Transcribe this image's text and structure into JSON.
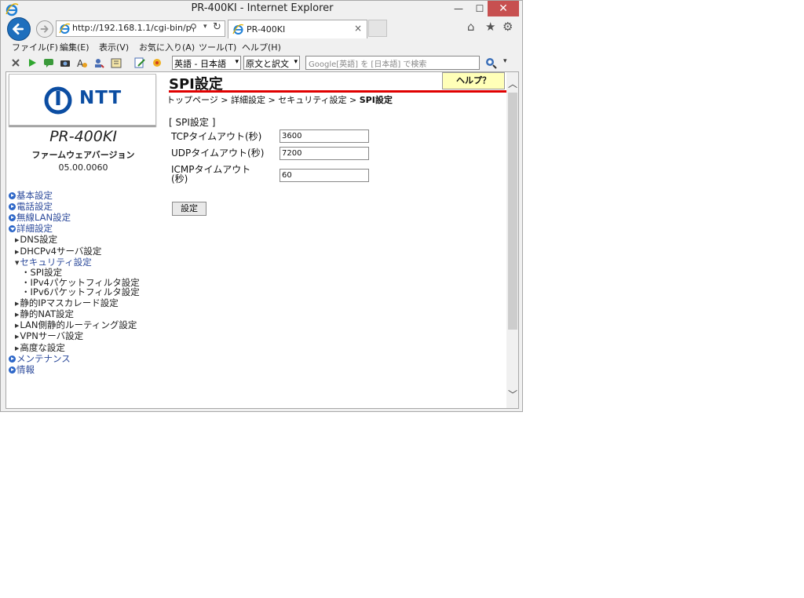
{
  "window": {
    "title": "PR-400KI - Internet Explorer",
    "min_symbol": "—",
    "max_symbol": "☐",
    "close_symbol": "✕"
  },
  "address": {
    "url": "http://192.168.1.1/cgi-bin/p",
    "search_symbol": "⚲",
    "drop_symbol": "▾",
    "refresh_symbol": "↻"
  },
  "tab": {
    "label": "PR-400KI",
    "close_symbol": "×"
  },
  "toolbar_right": {
    "home_symbol": "⌂",
    "fav_symbol": "★",
    "gear_symbol": "⚙"
  },
  "menu": {
    "items": [
      "ファイル(F)",
      "編集(E)",
      "表示(V)",
      "お気に入り(A)",
      "ツール(T)",
      "ヘルプ(H)"
    ]
  },
  "translate_toolbar": {
    "lang_select": "英語 - 日本語",
    "mode_select": "原文と訳文",
    "search_placeholder": "Google[英語] を [日本語] で検索",
    "arrow": "▾"
  },
  "sidebar": {
    "logo_text": "NTT",
    "model": "PR-400KI",
    "fw_label": "ファームウェアバージョン",
    "fw_version": "05.00.0060",
    "nav": [
      {
        "label": "基本設定"
      },
      {
        "label": "電話設定"
      },
      {
        "label": "無線LAN設定"
      },
      {
        "label": "詳細設定"
      },
      {
        "label": "DNS設定"
      },
      {
        "label": "DHCPv4サーバ設定"
      },
      {
        "label": "セキュリティ設定"
      },
      {
        "label": "SPI設定"
      },
      {
        "label": "IPv4パケットフィルタ設定"
      },
      {
        "label": "IPv6パケットフィルタ設定"
      },
      {
        "label": "静的IPマスカレード設定"
      },
      {
        "label": "静的NAT設定"
      },
      {
        "label": "LAN側静的ルーティング設定"
      },
      {
        "label": "VPNサーバ設定"
      },
      {
        "label": "高度な設定"
      },
      {
        "label": "メンテナンス"
      },
      {
        "label": "情報"
      }
    ]
  },
  "main": {
    "title": "SPI設定",
    "help_label": "ヘルプ？",
    "breadcrumb": {
      "path": "トップページ > 詳細設定 > セキュリティ設定 > ",
      "current": "SPI設定"
    },
    "section_title": "[ SPI設定 ]",
    "fields": [
      {
        "label": "TCPタイムアウト(秒)",
        "value": "3600"
      },
      {
        "label": "UDPタイムアウト(秒)",
        "value": "7200"
      },
      {
        "label_line1": "ICMPタイムアウト",
        "label_line2": "(秒)",
        "value": "60"
      }
    ],
    "submit_label": "設定"
  },
  "scrollbar": {
    "up_symbol": "︿",
    "down_symbol": "﹀"
  }
}
